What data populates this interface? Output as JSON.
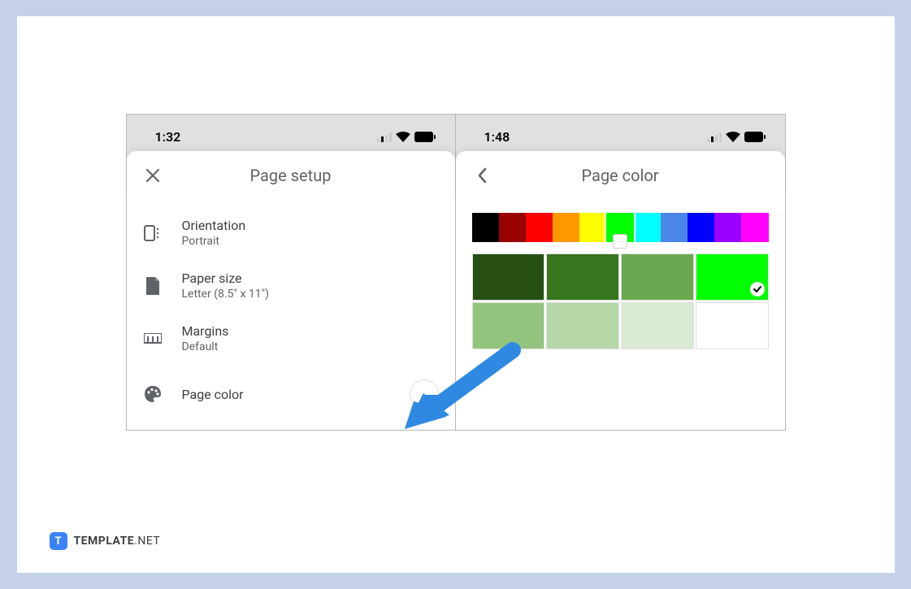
{
  "left": {
    "status_time": "1:32",
    "title": "Page setup",
    "items": [
      {
        "icon": "orientation",
        "label": "Orientation",
        "value": "Portrait"
      },
      {
        "icon": "paper",
        "label": "Paper size",
        "value": "Letter (8.5\" x 11\")"
      },
      {
        "icon": "margins",
        "label": "Margins",
        "value": "Default"
      }
    ],
    "page_color_label": "Page color",
    "page_color_current": "#ffffff"
  },
  "right": {
    "status_time": "1:48",
    "title": "Page color",
    "hue_colors": [
      "#000000",
      "#990000",
      "#ff0000",
      "#ff9900",
      "#ffff00",
      "#00ff00",
      "#00ffff",
      "#4a86e8",
      "#0000ff",
      "#9900ff",
      "#ff00ff"
    ],
    "hue_selected_index": 5,
    "shade_colors": [
      "#274e13",
      "#38761d",
      "#6aa84f",
      "#00ff00",
      "#93c47d",
      "#b6d7a8",
      "#d9ead3",
      "#ffffff"
    ],
    "shade_selected_index": 3
  },
  "branding": {
    "text_bold": "TEMPLATE",
    "text_light": ".NET",
    "icon_letter": "T"
  },
  "arrow_color": "#2f89e3"
}
